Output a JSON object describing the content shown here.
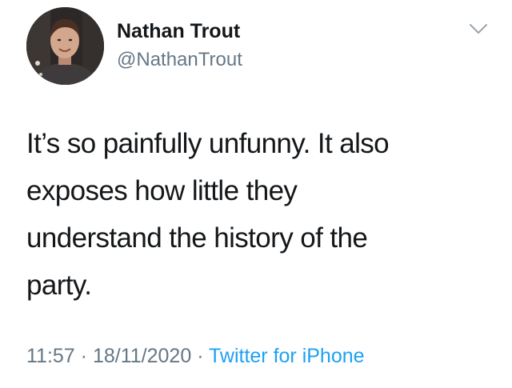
{
  "user": {
    "display_name": "Nathan Trout",
    "handle": "@NathanTrout",
    "avatar_icon": "user-photo"
  },
  "tweet": {
    "text_lines": [
      "It’s so painfully unfunny. It also",
      "exposes how little they",
      "understand the history of the",
      "party."
    ],
    "time": "11:57",
    "separator": "·",
    "date": "18/11/2020",
    "source": "Twitter for iPhone"
  },
  "menu": {
    "icon": "chevron-down-icon"
  },
  "colors": {
    "text": "#14171a",
    "secondary": "#657786",
    "link": "#1da1f2"
  }
}
